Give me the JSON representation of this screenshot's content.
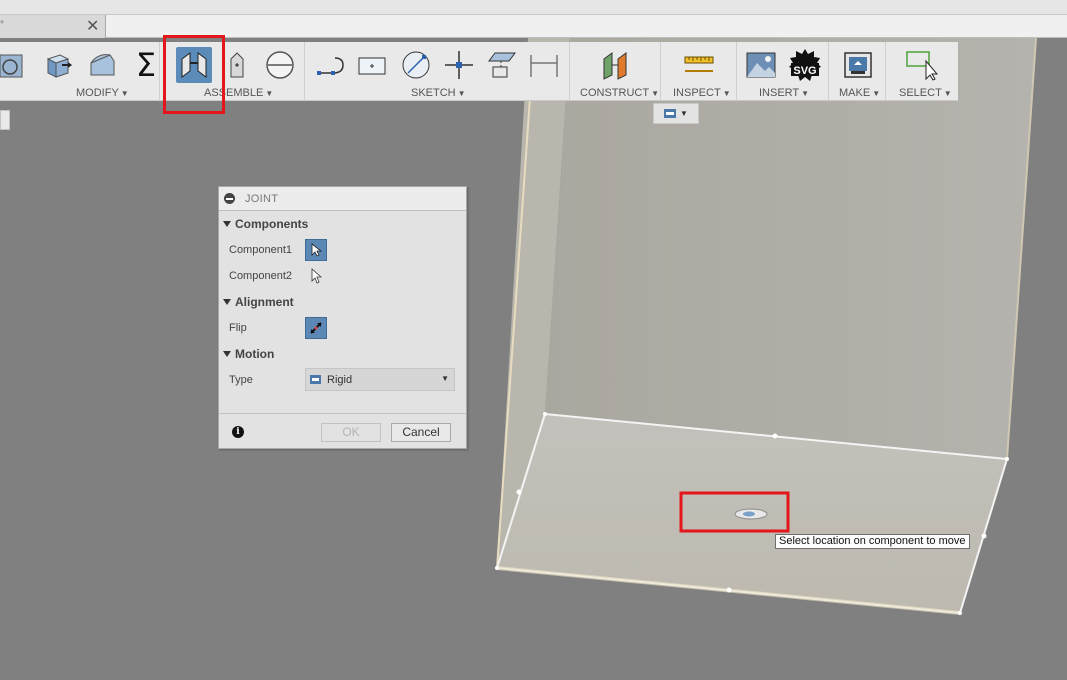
{
  "document_tab": {
    "name": "*",
    "close": "✕"
  },
  "toolbar": {
    "groups": [
      {
        "label": "MODIFY"
      },
      {
        "label": "ASSEMBLE"
      },
      {
        "label": "SKETCH"
      },
      {
        "label": "CONSTRUCT"
      },
      {
        "label": "INSPECT"
      },
      {
        "label": "INSERT"
      },
      {
        "label": "MAKE"
      },
      {
        "label": "SELECT"
      }
    ],
    "caret": "▼",
    "sum_symbol": "Σ",
    "svg_badge": "SVG"
  },
  "view_toggle": {
    "caret": "▼"
  },
  "joint_dialog": {
    "title": "JOINT",
    "sections": {
      "components": "Components",
      "alignment": "Alignment",
      "motion": "Motion"
    },
    "component1_label": "Component1",
    "component2_label": "Component2",
    "flip_label": "Flip",
    "type_label": "Type",
    "type_value": "Rigid",
    "type_caret": "▼",
    "ok_label": "OK",
    "cancel_label": "Cancel",
    "info_glyph": "i"
  },
  "tooltip": {
    "text": "Select location on component to move"
  },
  "colors": {
    "highlight": "#e3161b",
    "active_button": "#5b8bb8",
    "model_face": "#c3c0b8",
    "background": "#808080"
  }
}
